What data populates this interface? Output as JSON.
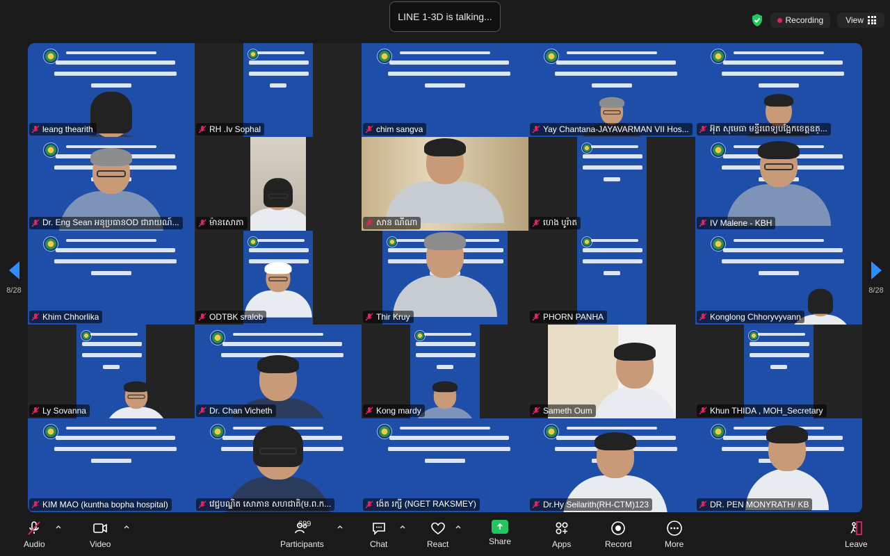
{
  "talking_banner": "LINE 1-3D is talking...",
  "recording": {
    "label": "Recording",
    "dot_color": "#e0245e",
    "shield_color": "#22c55e"
  },
  "view_button": {
    "label": "View"
  },
  "page_indicator": {
    "left": "8/28",
    "right": "8/28"
  },
  "tiles": [
    {
      "name": "leang thearith",
      "muted": true
    },
    {
      "name": "RH .Iv Sophal",
      "muted": true
    },
    {
      "name": "chim sangva",
      "muted": true
    },
    {
      "name": "Yay Chantana-JAYAVARMAN VII Hos...",
      "muted": true
    },
    {
      "name": "អ៊ុត សុមេធា មន្ទីរពេទ្យបង្អែកខេត្តឧត្...",
      "muted": true
    },
    {
      "name": "Dr. Eng Sean អនុប្រធានOD ជារាយណ៍...",
      "muted": true
    },
    {
      "name": "ម៉ានសោភា",
      "muted": true
    },
    {
      "name": "សាន ណីណា",
      "muted": true
    },
    {
      "name": "ហេង បូរ៉ាត",
      "muted": true
    },
    {
      "name": "IV Malene - KBH",
      "muted": true
    },
    {
      "name": "Khim Chhorlika",
      "muted": true
    },
    {
      "name": "ODTBK sralob",
      "muted": true
    },
    {
      "name": "Thir Kruy",
      "muted": true
    },
    {
      "name": "PHORN PANHA",
      "muted": true
    },
    {
      "name": "Konglong Chhoryvyvann",
      "muted": true
    },
    {
      "name": "Ly Sovanna",
      "muted": true
    },
    {
      "name": "Dr. Chan Vicheth",
      "muted": true
    },
    {
      "name": "Kong mardy",
      "muted": true
    },
    {
      "name": "Sameth Oum",
      "muted": true
    },
    {
      "name": "Khun THIDA , MOH_Secretary",
      "muted": true
    },
    {
      "name": "KIM MAO (kuntha bopha hospital)",
      "muted": true
    },
    {
      "name": "វេជ្ជបណ្ឌិត សោភាន សហជាតិ(ម.ព.ក...",
      "muted": true
    },
    {
      "name": "ង៉េត រក្សី (NGET RAKSMEY)",
      "muted": true
    },
    {
      "name": "Dr.Hy Seilarith(RH-CTM)123",
      "muted": true
    },
    {
      "name": "DR. PEN MONYRATH/ KB",
      "muted": true
    }
  ],
  "toolbar": {
    "audio": "Audio",
    "video": "Video",
    "participants": "Participants",
    "participants_count": "699",
    "chat": "Chat",
    "react": "React",
    "share": "Share",
    "apps": "Apps",
    "record": "Record",
    "more": "More",
    "leave": "Leave"
  },
  "colors": {
    "slide_blue": "#1f4ea8",
    "accent": "#2d8cff",
    "leave_red": "#e0245e",
    "share_green": "#22c55e"
  }
}
